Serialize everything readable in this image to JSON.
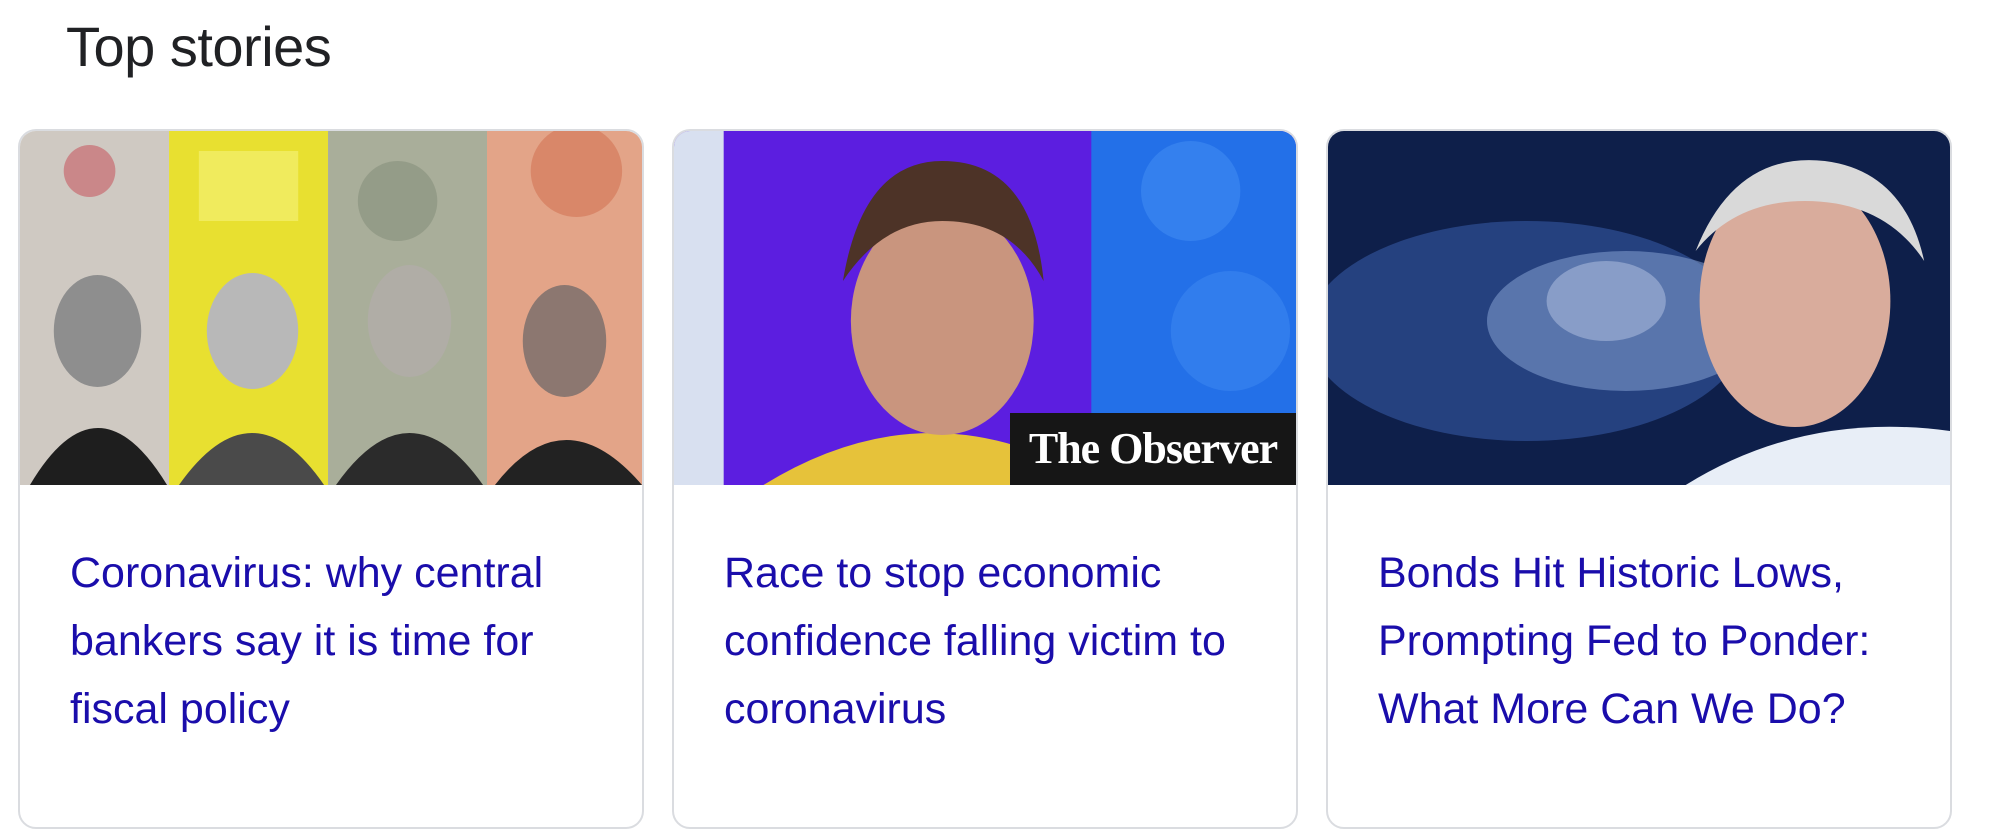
{
  "section": {
    "title": "Top stories"
  },
  "stories": [
    {
      "headline": "Coronavirus: why central bankers say it is time for fiscal policy",
      "thumbnail": "four-central-bankers-collage"
    },
    {
      "headline": "Race to stop economic confidence falling victim to coronavirus",
      "thumbnail": "woman-speaking-blue-backdrop",
      "watermark": "The Observer"
    },
    {
      "headline": "Bonds Hit Historic Lows, Prompting Fed to Ponder: What More Can We Do?",
      "thumbnail": "man-blue-blurred-background"
    }
  ],
  "colors": {
    "link": "#1a0dab",
    "title": "#202124",
    "card_border": "#dadce0"
  }
}
